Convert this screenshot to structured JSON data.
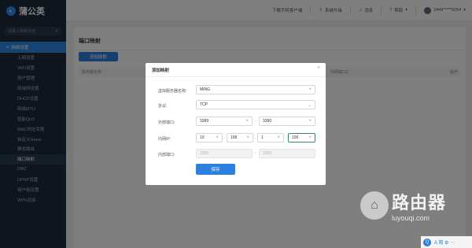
{
  "app": {
    "logo_text": "蒲公英"
  },
  "sidebar": {
    "search_placeholder": "请输入搜索内容",
    "device_label": "网络设置",
    "items": [
      "上网设置",
      "WiFi设置",
      "用户管理",
      "局域网设置",
      "DHCP设置",
      "网络MTU",
      "智能QoS",
      "MAC地址克隆",
      "自定义Hosts",
      "静态路由",
      "端口映射",
      "DMZ",
      "UPNP设置",
      "用户组设置",
      "WPS连接"
    ],
    "active_index": 10
  },
  "topbar": {
    "download": "下载手机客户端",
    "upgrade": "系统升级",
    "notice": "消息",
    "help": "帮助",
    "account": "3449*****8254"
  },
  "page": {
    "title": "端口映射",
    "add_button": "添加映射",
    "columns": [
      "服务器名称",
      "内网端口2",
      "操作"
    ]
  },
  "dialog": {
    "title": "添加映射",
    "close": "×",
    "labels": {
      "name": "虚拟服务器名称:",
      "protocol": "协议:",
      "ext_port": "外部端口:",
      "lan_ip": "内网IP:",
      "int_port": "内部端口:"
    },
    "values": {
      "name": "MING",
      "protocol": "TCP",
      "ext_port_from": "3389",
      "ext_port_to": "3390",
      "ip1": "10",
      "ip2": "168",
      "ip3": "1",
      "ip4": "100",
      "int_port_from": "3389",
      "int_port_to": "3390"
    },
    "dash": "-",
    "dot": ".",
    "save": "保存"
  },
  "watermark": {
    "cn": "路由器",
    "en": "luyouqi.com"
  },
  "tray": {
    "q": "Q",
    "items": "A 简 ⚙ ⋯"
  }
}
